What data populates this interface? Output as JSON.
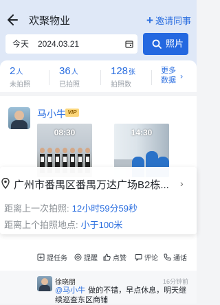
{
  "header": {
    "title": "欢聚物业",
    "invite_label": "邀请同事",
    "date_label": "今天",
    "date_value": "2024.03.21",
    "photo_button_label": "照片"
  },
  "stats": [
    {
      "value": "2",
      "unit": "人",
      "label": "未拍照"
    },
    {
      "value": "36",
      "unit": "人",
      "label": "已拍照"
    },
    {
      "value": "128",
      "unit": "张",
      "label": "拍照数"
    }
  ],
  "more_data_line1": "更多",
  "more_data_line2": "数据",
  "post": {
    "author": "马小牛",
    "badge": "VIP",
    "photos": [
      {
        "time": "08:30",
        "icon": "guards-saluting-photo"
      },
      {
        "time": "14:30",
        "icon": "workers-cleaning-photo"
      }
    ],
    "location": "广州市番禺区番禺万达广场B2栋...",
    "distance_last_photo_label": "距离上一次拍照:",
    "distance_last_photo_value": "12小时59分59秒",
    "distance_last_place_label": "距离上个拍照地点:",
    "distance_last_place_value": "小于100米",
    "actions": [
      "提任务",
      "提醒",
      "点赞",
      "评论",
      "通话"
    ]
  },
  "comment": {
    "name": "徐晓朋",
    "time": "16分钟前",
    "mention": "@马小牛",
    "text": "做的不错，早点休息，明天继续巡查东区商铺"
  },
  "colors": {
    "accent": "#2c6fe0",
    "header_bg": "#dfe8f7",
    "vip": "#fbd67a"
  }
}
